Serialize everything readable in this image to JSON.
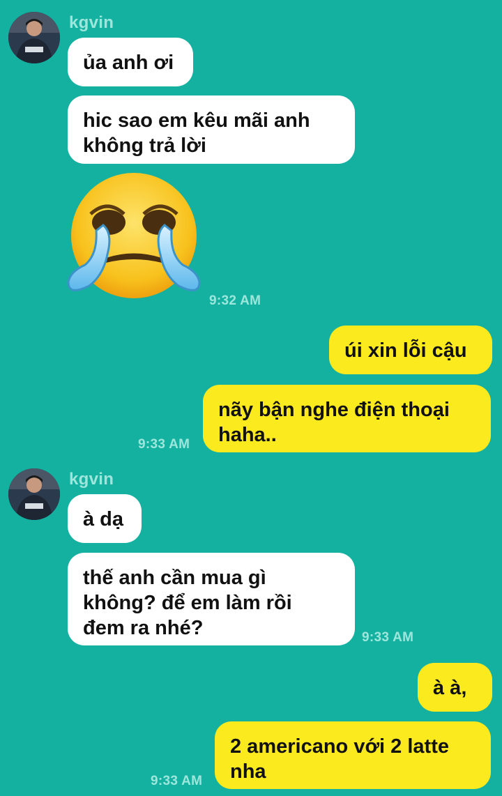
{
  "conversation": {
    "messages": [
      {
        "sender": "kgvin",
        "text": "ủa anh ơi"
      },
      {
        "text": "hic sao em kêu mãi anh\nkhông trả lời"
      },
      {
        "sticker": "loudly-crying-face",
        "time": "9:32 AM"
      },
      {
        "text": "úi xin lỗi cậu"
      },
      {
        "text": "nãy bận nghe điện thoại\nhaha..",
        "time": "9:33 AM"
      },
      {
        "sender": "kgvin",
        "text": "à dạ"
      },
      {
        "text": "thế anh cần mua gì\nkhông? để em làm rồi\nđem ra nhé?",
        "time": "9:33 AM"
      },
      {
        "text": "à à,"
      },
      {
        "text": "2 americano với 2 latte\nnha",
        "time": "9:33 AM"
      }
    ]
  },
  "colors": {
    "background": "#14b1a1",
    "incoming_bubble": "#ffffff",
    "outgoing_bubble": "#fbea1e",
    "meta_text": "#9de6dc"
  }
}
